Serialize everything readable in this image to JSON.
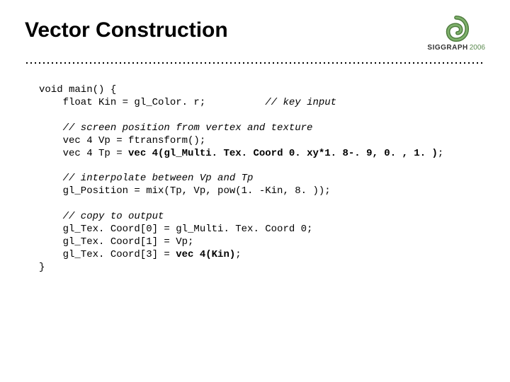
{
  "title": "Vector Construction",
  "brand": {
    "name": "SIGGRAPH",
    "year": "2006"
  },
  "code": {
    "l1": "void main() {",
    "l2a": "    float Kin = gl_Color. r;          ",
    "l2b": "// key input",
    "l3": "    // screen position from vertex and texture",
    "l4": "    vec 4 Vp = ftransform();",
    "l5a": "    vec 4 Tp = ",
    "l5b": "vec 4(gl_Multi. Tex. Coord 0. xy*1. 8-. 9, 0. , 1. )",
    "l5c": ";",
    "l6": "    // interpolate between Vp and Tp",
    "l7": "    gl_Position = mix(Tp, Vp, pow(1. -Kin, 8. ));",
    "l8": "    // copy to output",
    "l9": "    gl_Tex. Coord[0] = gl_Multi. Tex. Coord 0;",
    "l10": "    gl_Tex. Coord[1] = Vp;",
    "l11a": "    gl_Tex. Coord[3] = ",
    "l11b": "vec 4(Kin)",
    "l11c": ";",
    "l12": "}"
  }
}
